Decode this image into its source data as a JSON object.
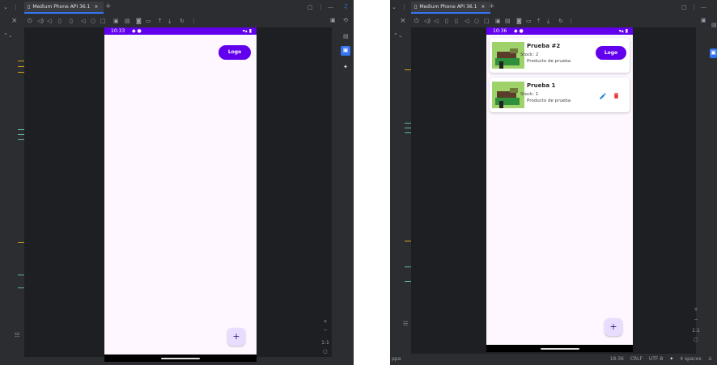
{
  "left_window": {
    "tab_label": "Medium Phone API 36.1",
    "tab_close": "×",
    "tab_add": "+",
    "emulator": {
      "time": "10:33",
      "status_icons": "◆ ●",
      "sys_icons": "▾▴ ▮",
      "logo_label": "Logo",
      "fab_label": "+"
    },
    "zoom_ratio": "1:1"
  },
  "right_window": {
    "tab_label": "Medium Phone API 36.1",
    "tab_close": "×",
    "tab_add": "+",
    "emulator": {
      "time": "10:36",
      "status_icons": "◆ ●",
      "sys_icons": "▾▴ ▮",
      "logo_label": "Logo",
      "fab_label": "+",
      "products": [
        {
          "name": "Prueba #2",
          "stock": "Stock: 2",
          "description": "Producto de prueba"
        },
        {
          "name": "Prueba 1",
          "stock": "Stock: 1",
          "description": "Producto de prueba"
        }
      ]
    },
    "zoom_ratio": "1:1",
    "status_bar": {
      "left": "ppa",
      "cursor": "18:36",
      "line_ending": "CRLF",
      "encoding": "UTF-8",
      "indent": "4 spaces"
    }
  },
  "colors": {
    "ide_bg": "#2b2d30",
    "editor_bg": "#1e1f22",
    "accent": "#3574f0",
    "app_primary": "#6200ee",
    "app_surface": "#fef7ff",
    "fab": "#e9ddff",
    "edit_icon": "#1e88e5",
    "delete_icon": "#e53935"
  }
}
